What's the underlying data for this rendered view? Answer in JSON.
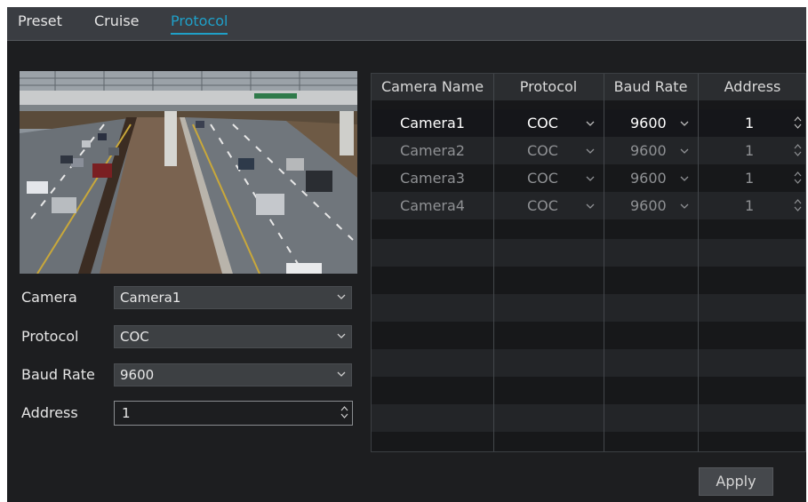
{
  "tabs": [
    {
      "label": "Preset",
      "active": false
    },
    {
      "label": "Cruise",
      "active": false
    },
    {
      "label": "Protocol",
      "active": true
    }
  ],
  "form": {
    "camera_label": "Camera",
    "camera_value": "Camera1",
    "protocol_label": "Protocol",
    "protocol_value": "COC",
    "baud_label": "Baud Rate",
    "baud_value": "9600",
    "address_label": "Address",
    "address_value": "1"
  },
  "table": {
    "headers": [
      "Camera Name",
      "Protocol",
      "Baud Rate",
      "Address"
    ],
    "rows": [
      {
        "name": "Camera1",
        "protocol": "COC",
        "baud": "9600",
        "address": "1",
        "selected": true
      },
      {
        "name": "Camera2",
        "protocol": "COC",
        "baud": "9600",
        "address": "1",
        "selected": false
      },
      {
        "name": "Camera3",
        "protocol": "COC",
        "baud": "9600",
        "address": "1",
        "selected": false
      },
      {
        "name": "Camera4",
        "protocol": "COC",
        "baud": "9600",
        "address": "1",
        "selected": false
      }
    ]
  },
  "apply_label": "Apply",
  "colors": {
    "accent": "#1fa0c8",
    "background": "#1d1e20",
    "tabbar": "#3a3d42"
  },
  "icons": {
    "dropdown": "chevron-down-icon",
    "spinner": "up-down-arrows-icon"
  }
}
